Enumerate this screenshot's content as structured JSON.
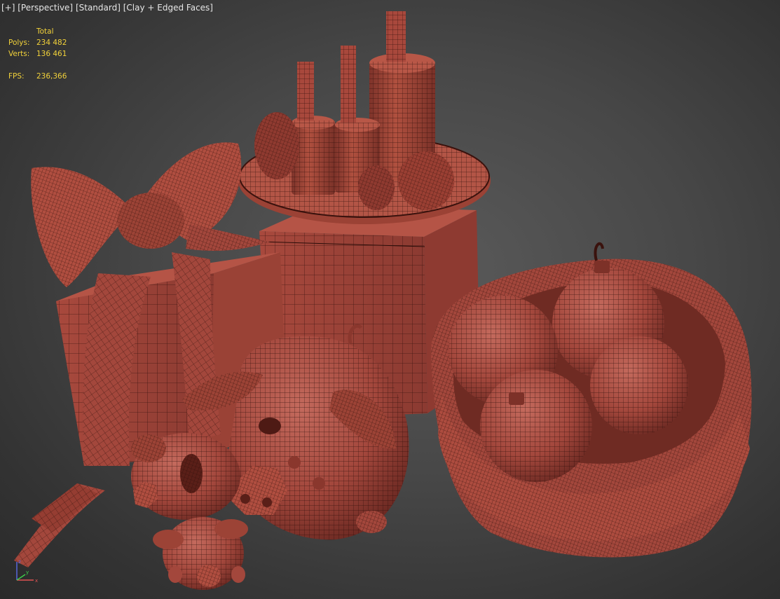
{
  "viewport": {
    "menu": {
      "plus": "[+]",
      "view": "[Perspective]",
      "shading_mode": "[Standard]",
      "display": "[Clay + Edged Faces]"
    },
    "stats": {
      "column_header": "Total",
      "polys_label": "Polys:",
      "polys_value": "234 482",
      "verts_label": "Verts:",
      "verts_value": "136 461",
      "fps_label": "FPS:",
      "fps_value": "236,366"
    },
    "axis": {
      "x_label": "x",
      "y_label": "y",
      "z_label": "z"
    }
  },
  "colors": {
    "clay": "#a3473c",
    "clay_dark": "#6d2a23",
    "wire": "#2a0d09",
    "stats_text": "#f2d23a",
    "menu_text": "#e6e6e6"
  }
}
